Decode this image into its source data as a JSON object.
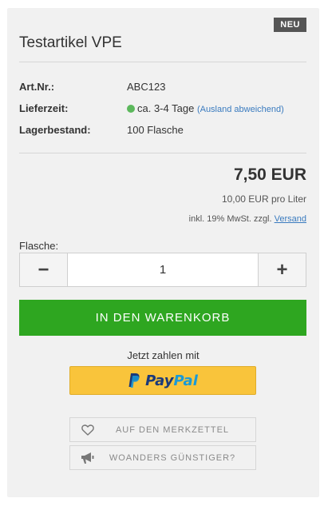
{
  "badge": "NEU",
  "title": "Testartikel VPE",
  "details": [
    {
      "key": "Art.Nr.:",
      "value": "ABC123"
    },
    {
      "key": "Lieferzeit:",
      "value": "ca. 3-4 Tage",
      "note": "(Ausland abweichend)",
      "status_color": "#5cb85c"
    },
    {
      "key": "Lagerbestand:",
      "value": "100 Flasche"
    }
  ],
  "price": "7,50 EUR",
  "base_price": "10,00 EUR pro Liter",
  "tax_text": "inkl. 19% MwSt. zzgl.",
  "shipping_link": "Versand",
  "quantity": {
    "label": "Flasche:",
    "value": "1",
    "minus": "−",
    "plus": "+"
  },
  "cart_button": "IN DEN WARENKORB",
  "pay_text": "Jetzt zahlen mit",
  "paypal": {
    "part1": "Pay",
    "part2": "Pal",
    "icon": "paypal-icon"
  },
  "wishlist_button": {
    "label": "AUF DEN MERKZETTEL",
    "icon": "heart-icon"
  },
  "cheaper_button": {
    "label": "WOANDERS GÜNSTIGER?",
    "icon": "megaphone-icon"
  },
  "colors": {
    "cart": "#2ea620",
    "paypal_bg": "#f9c43b",
    "link": "#3a7bbf",
    "panel": "#f1f1f1"
  }
}
